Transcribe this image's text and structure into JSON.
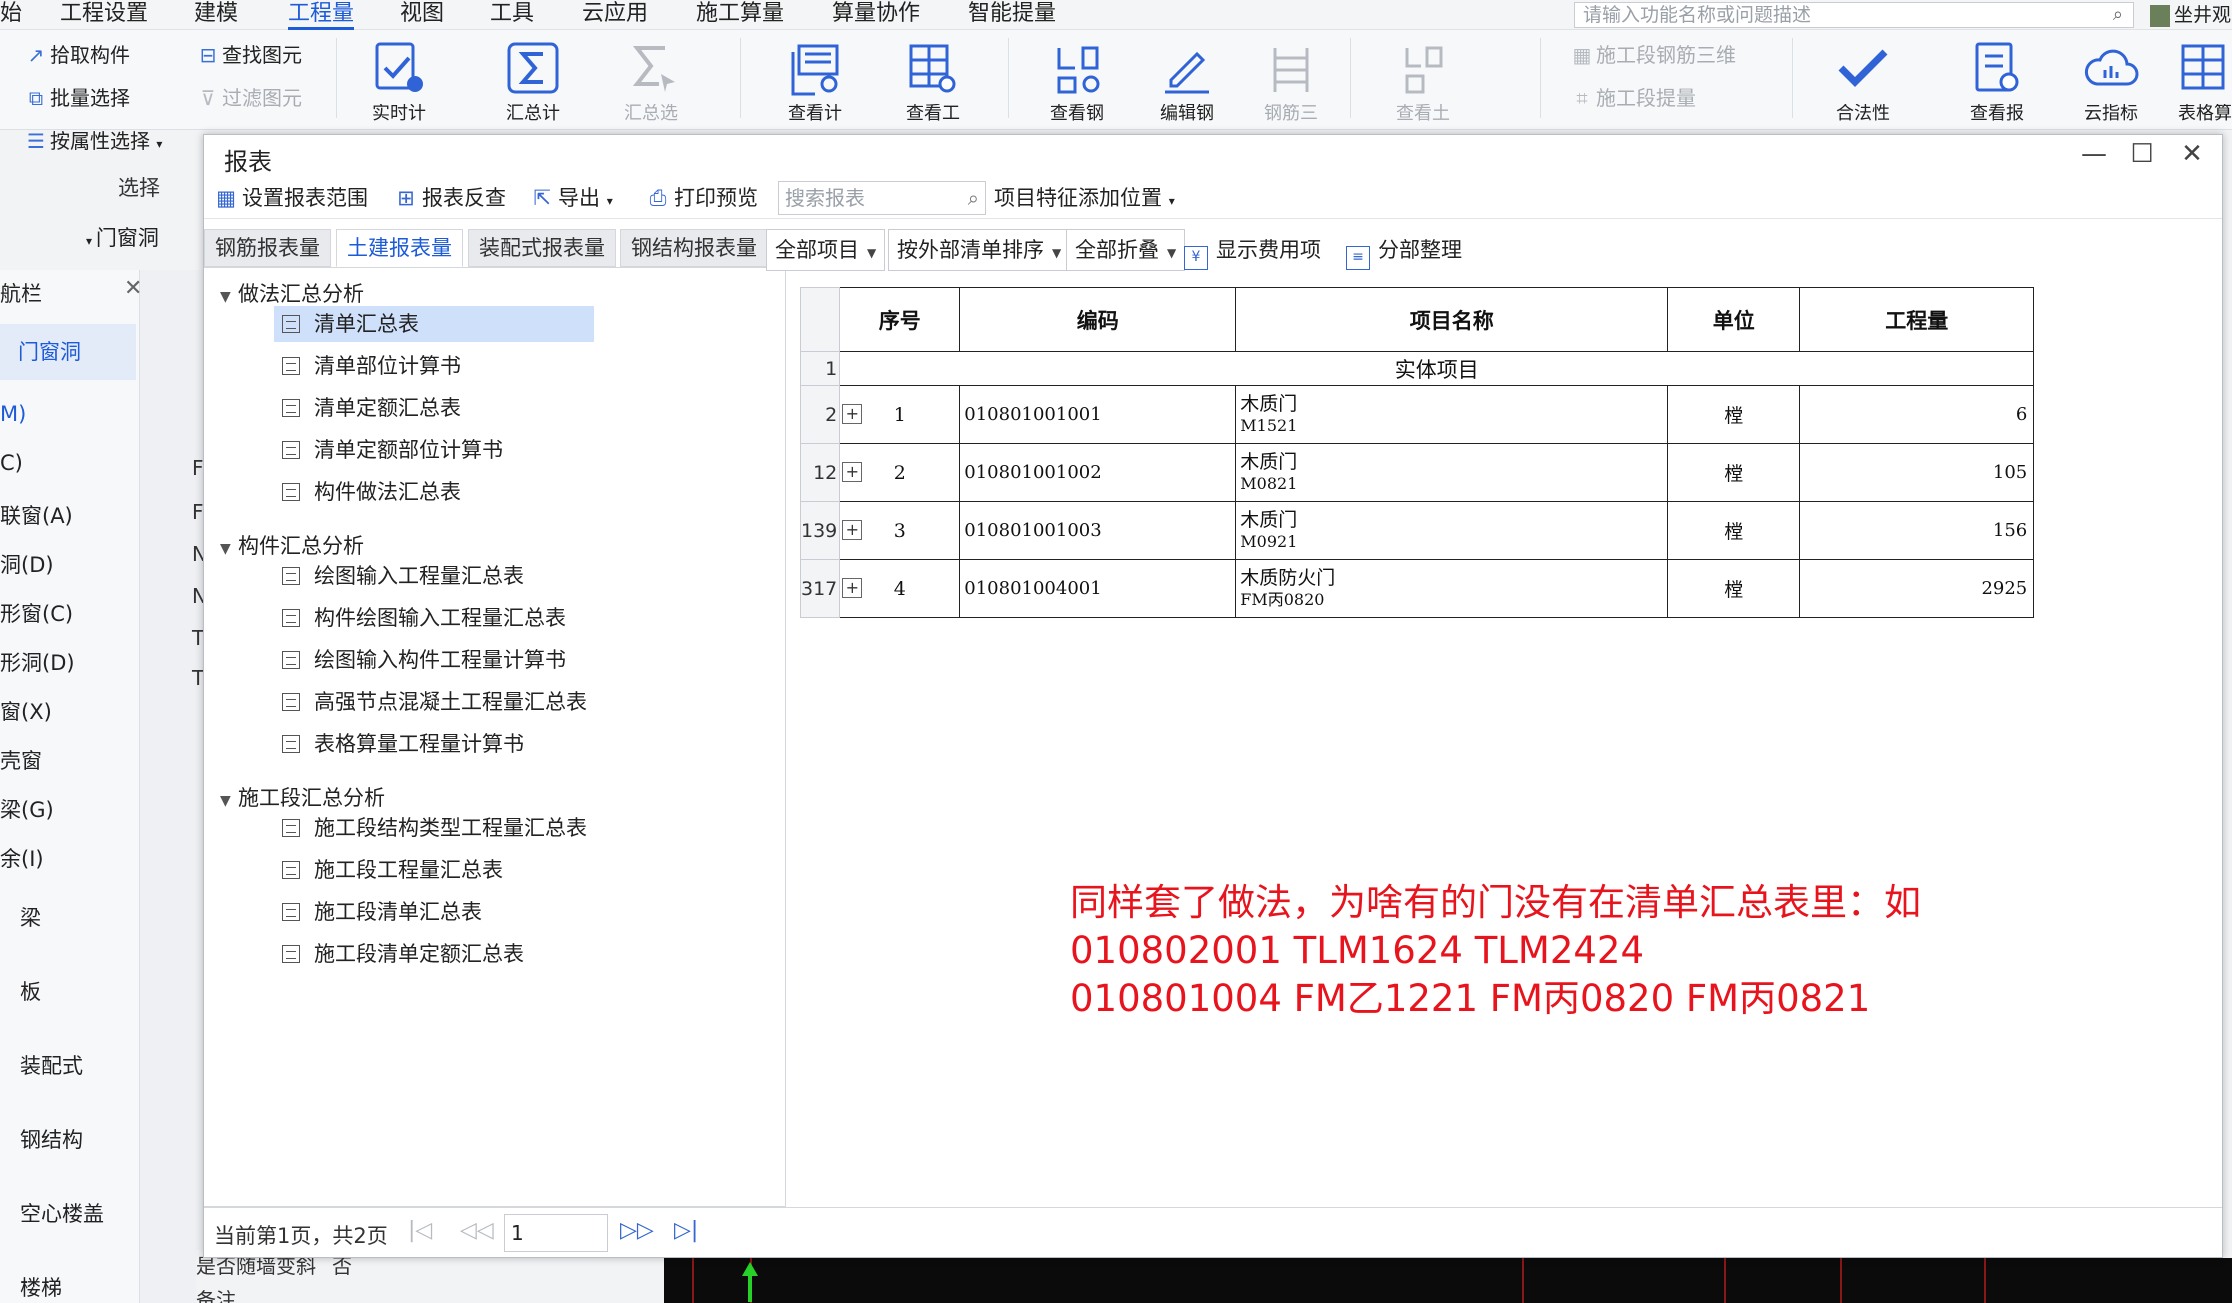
{
  "menu": [
    "始",
    "工程设置",
    "建模",
    "工程量",
    "视图",
    "工具",
    "云应用",
    "施工算量",
    "算量协作",
    "智能提量"
  ],
  "search_placeholder": "请输入功能名称或问题描述",
  "user_name": "坐井观",
  "ribbon": {
    "select_group": [
      "拾取构件",
      "批量选择",
      "按属性选择"
    ],
    "find_group": [
      "查找图元",
      "过滤图元"
    ],
    "group_label": "选择",
    "big_cut": [
      "实时计算",
      "汇总计算",
      "汇总选中图元",
      "查看计算式",
      "查看工程量",
      "查看钢筋量",
      "编辑钢筋",
      "钢筋三维",
      "查看土建量"
    ],
    "stage": [
      "施工段钢筋三维",
      "施工段提量"
    ],
    "right_cut": [
      "合法性检查",
      "查看报表",
      "云指标",
      "表格算量"
    ]
  },
  "left": {
    "dropdown": "门窗洞",
    "nav_title": "航栏",
    "nav_active": "门窗洞",
    "items": [
      "M)",
      "C)",
      "联窗(A)",
      "洞(D)",
      "形窗(C)",
      "形洞(D)",
      "窗(X)",
      "壳窗",
      "梁(G)",
      "余(I)",
      "梁",
      "板",
      "装配式",
      "钢结构",
      "空心楼盖",
      "楼梯"
    ],
    "mid_chars": [
      "F",
      "F",
      "N",
      "N",
      "T",
      "T"
    ],
    "bottom_rows": [
      "是否随墙变斜",
      "备注"
    ],
    "bottom_value": "否"
  },
  "window": {
    "title": "报表",
    "controls": {
      "min": "—",
      "max": "☐",
      "close": "✕"
    },
    "toolbar": [
      "设置报表范围",
      "报表反查",
      "导出",
      "打印预览"
    ],
    "toolbar_search": "搜索报表",
    "toolbar_extra": "项目特征添加位置",
    "tabs": [
      "钢筋报表量",
      "土建报表量",
      "装配式报表量",
      "钢结构报表量"
    ],
    "tree": [
      {
        "group": "做法汇总分析",
        "items": [
          "清单汇总表",
          "清单部位计算书",
          "清单定额汇总表",
          "清单定额部位计算书",
          "构件做法汇总表"
        ]
      },
      {
        "group": "构件汇总分析",
        "items": [
          "绘图输入工程量汇总表",
          "构件绘图输入工程量汇总表",
          "绘图输入构件工程量计算书",
          "高强节点混凝土工程量汇总表",
          "表格算量工程量计算书"
        ]
      },
      {
        "group": "施工段汇总分析",
        "items": [
          "施工段结构类型工程量汇总表",
          "施工段工程量汇总表",
          "施工段清单汇总表",
          "施工段清单定额汇总表"
        ]
      }
    ],
    "selected_item": "清单汇总表",
    "controls_bar": {
      "dd1": "全部项目",
      "dd2": "按外部清单排序",
      "dd3": "全部折叠",
      "cb1": "显示费用项",
      "cb2": "分部整理"
    },
    "table": {
      "headers": [
        "序号",
        "编码",
        "项目名称",
        "单位",
        "工程量"
      ],
      "section": {
        "row_no": "1",
        "label": "实体项目"
      },
      "rows": [
        {
          "row_no": "2",
          "idx": "1",
          "code": "010801001001",
          "name": "木质门",
          "sub": "M1521",
          "unit": "樘",
          "qty": "6"
        },
        {
          "row_no": "12",
          "idx": "2",
          "code": "010801001002",
          "name": "木质门",
          "sub": "M0821",
          "unit": "樘",
          "qty": "105"
        },
        {
          "row_no": "139",
          "idx": "3",
          "code": "010801001003",
          "name": "木质门",
          "sub": "M0921",
          "unit": "樘",
          "qty": "156"
        },
        {
          "row_no": "317",
          "idx": "4",
          "code": "010801004001",
          "name": "木质防火门",
          "sub": "FM丙0820",
          "unit": "樘",
          "qty": "2925"
        }
      ]
    },
    "note": [
      "同样套了做法，为啥有的门没有在清单汇总表里：如",
      "010802001 TLM1624 TLM2424",
      "010801004 FM乙1221 FM丙0820 FM丙0821"
    ],
    "pager": {
      "text": "当前第1页，共2页",
      "page": "1"
    }
  },
  "colors": {
    "accent": "#1d5bd8",
    "note": "#e8141d"
  }
}
